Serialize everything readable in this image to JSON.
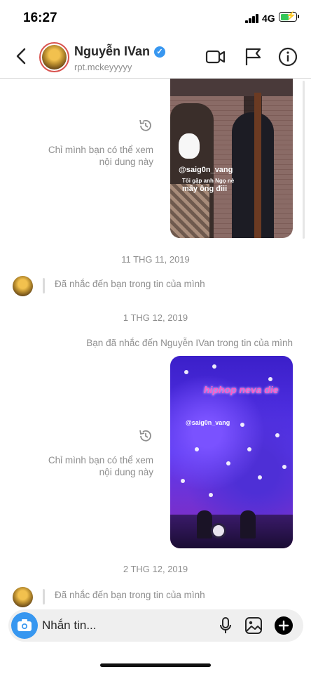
{
  "status": {
    "time": "16:27",
    "network": "4G",
    "battery_level": 0.55
  },
  "header": {
    "name": "Nguyễn IVan",
    "username": "rpt.mckeyyyyy",
    "icons": [
      "back-arrow-icon",
      "video-call-icon",
      "flag-icon",
      "info-icon"
    ]
  },
  "messages": {
    "story1_note": "Chỉ mình bạn có thể xem nội dung này",
    "story1_tag": "@saig0n_vang",
    "story1_sub": "Tối gặp anh Ngọ nè",
    "story1_msg": "mấy ông điii",
    "ts1": "11 THG 11, 2019",
    "mention1": "Đã nhắc đến bạn trong tin của mình",
    "ts2": "1 THG 12, 2019",
    "sent_mention": "Bạn đã nhắc đến Nguyễn IVan trong tin của mình",
    "story2_note": "Chỉ mình bạn có thể xem nội dung này",
    "story2_title": "hiphop neva die",
    "story2_tag": "@saig0n_vang",
    "ts3": "2 THG 12, 2019",
    "mention2": "Đã nhắc đến bạn trong tin của mình"
  },
  "composer": {
    "placeholder": "Nhắn tin...",
    "icons": [
      "camera-icon",
      "microphone-icon",
      "gallery-icon",
      "add-icon"
    ],
    "accent": "#3797f0"
  }
}
